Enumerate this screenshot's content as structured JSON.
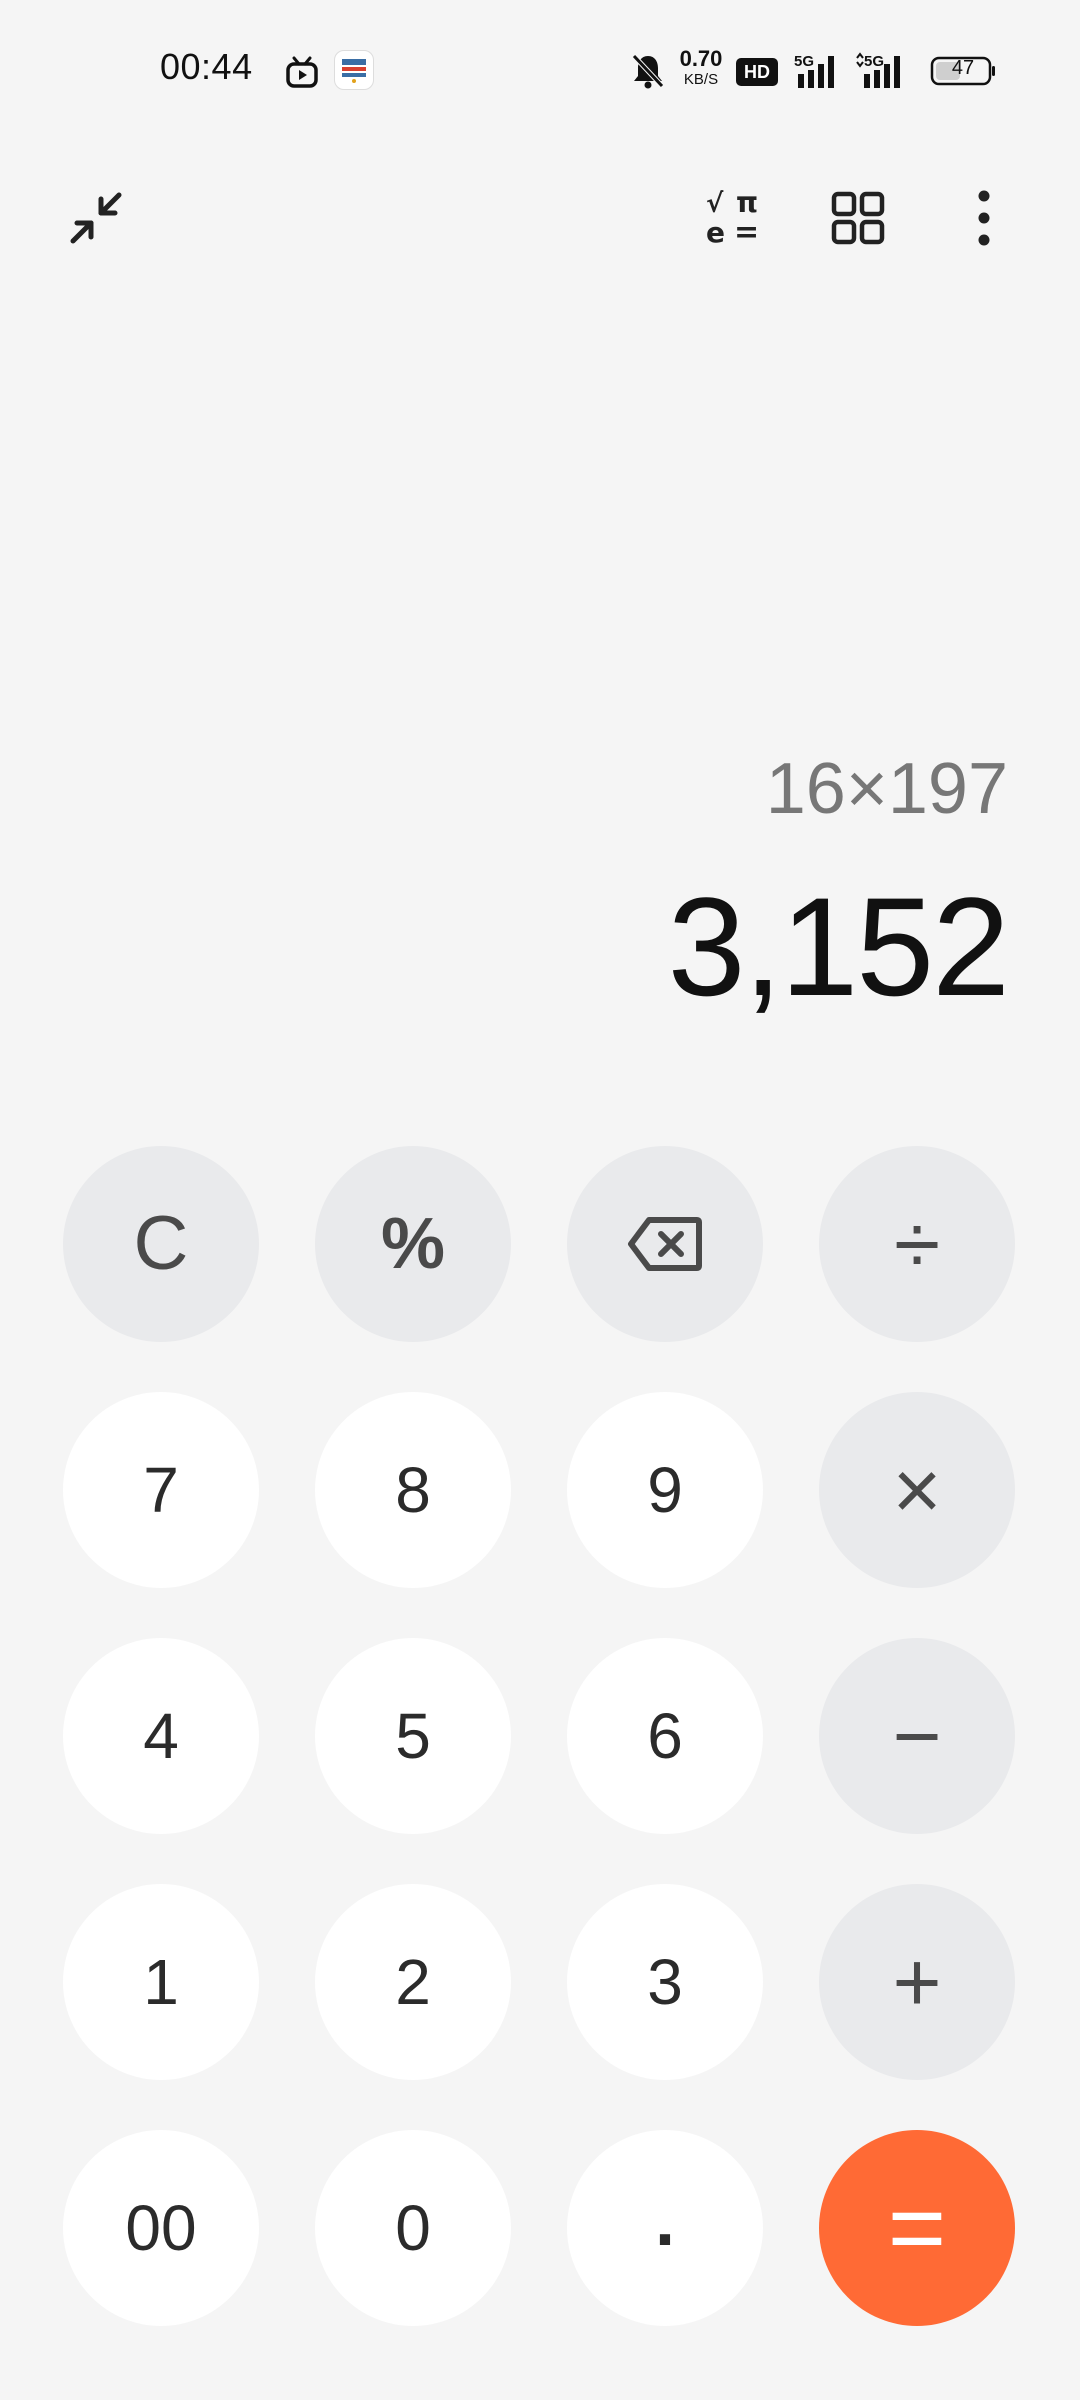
{
  "status_bar": {
    "time": "00:44",
    "net_speed_value": "0.70",
    "net_speed_unit": "KB/S",
    "hd_label": "HD",
    "signal1_label": "5G",
    "signal2_label": "5G",
    "battery_level": "47",
    "icons": [
      "tv-icon",
      "app-badge-icon",
      "bell-muted-icon",
      "signal-icon",
      "signal-icon",
      "battery-icon"
    ]
  },
  "toolbar": {
    "icons": [
      "collapse-arrows-icon",
      "scientific-mode-icon",
      "grid-icon",
      "more-vertical-icon"
    ],
    "sci_sqrt": "√",
    "sci_pi": "π",
    "sci_e": "e",
    "sci_eq": "="
  },
  "display": {
    "expression": "16×197",
    "result": "3,152"
  },
  "keypad": {
    "row1": [
      "C",
      "%",
      "⌫",
      "÷"
    ],
    "row2": [
      "7",
      "8",
      "9",
      "×"
    ],
    "row3": [
      "4",
      "5",
      "6",
      "−"
    ],
    "row4": [
      "1",
      "2",
      "3",
      "+"
    ],
    "row5": [
      "00",
      "0",
      ".",
      "="
    ]
  },
  "colors": {
    "background": "#f5f5f5",
    "number_key": "#ffffff",
    "operator_key": "#e9eaec",
    "equals_key": "#ff6a35"
  }
}
